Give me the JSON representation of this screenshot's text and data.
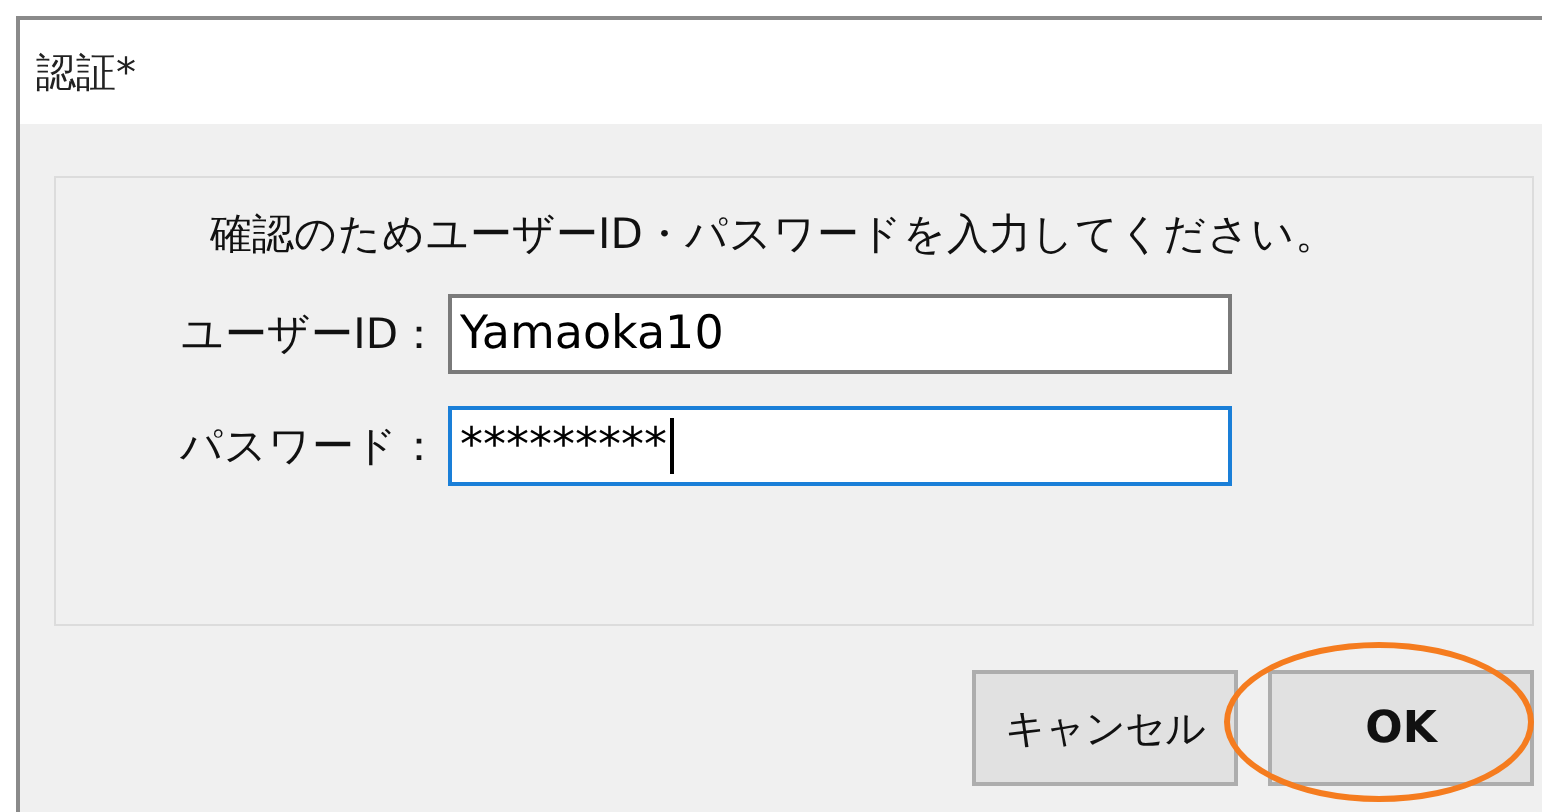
{
  "window": {
    "title": "認証*"
  },
  "message": "確認のためユーザーID・パスワードを入力してください。",
  "fields": [
    {
      "label": "ユーザーID：",
      "value": "Yamaoka10",
      "focused": false
    },
    {
      "label": "パスワード：",
      "value": "*********",
      "focused": true
    }
  ],
  "buttons": [
    {
      "label": "キャンセル",
      "kind": "normal",
      "highlighted": false
    },
    {
      "label": "OK",
      "kind": "default",
      "highlighted": true
    }
  ]
}
